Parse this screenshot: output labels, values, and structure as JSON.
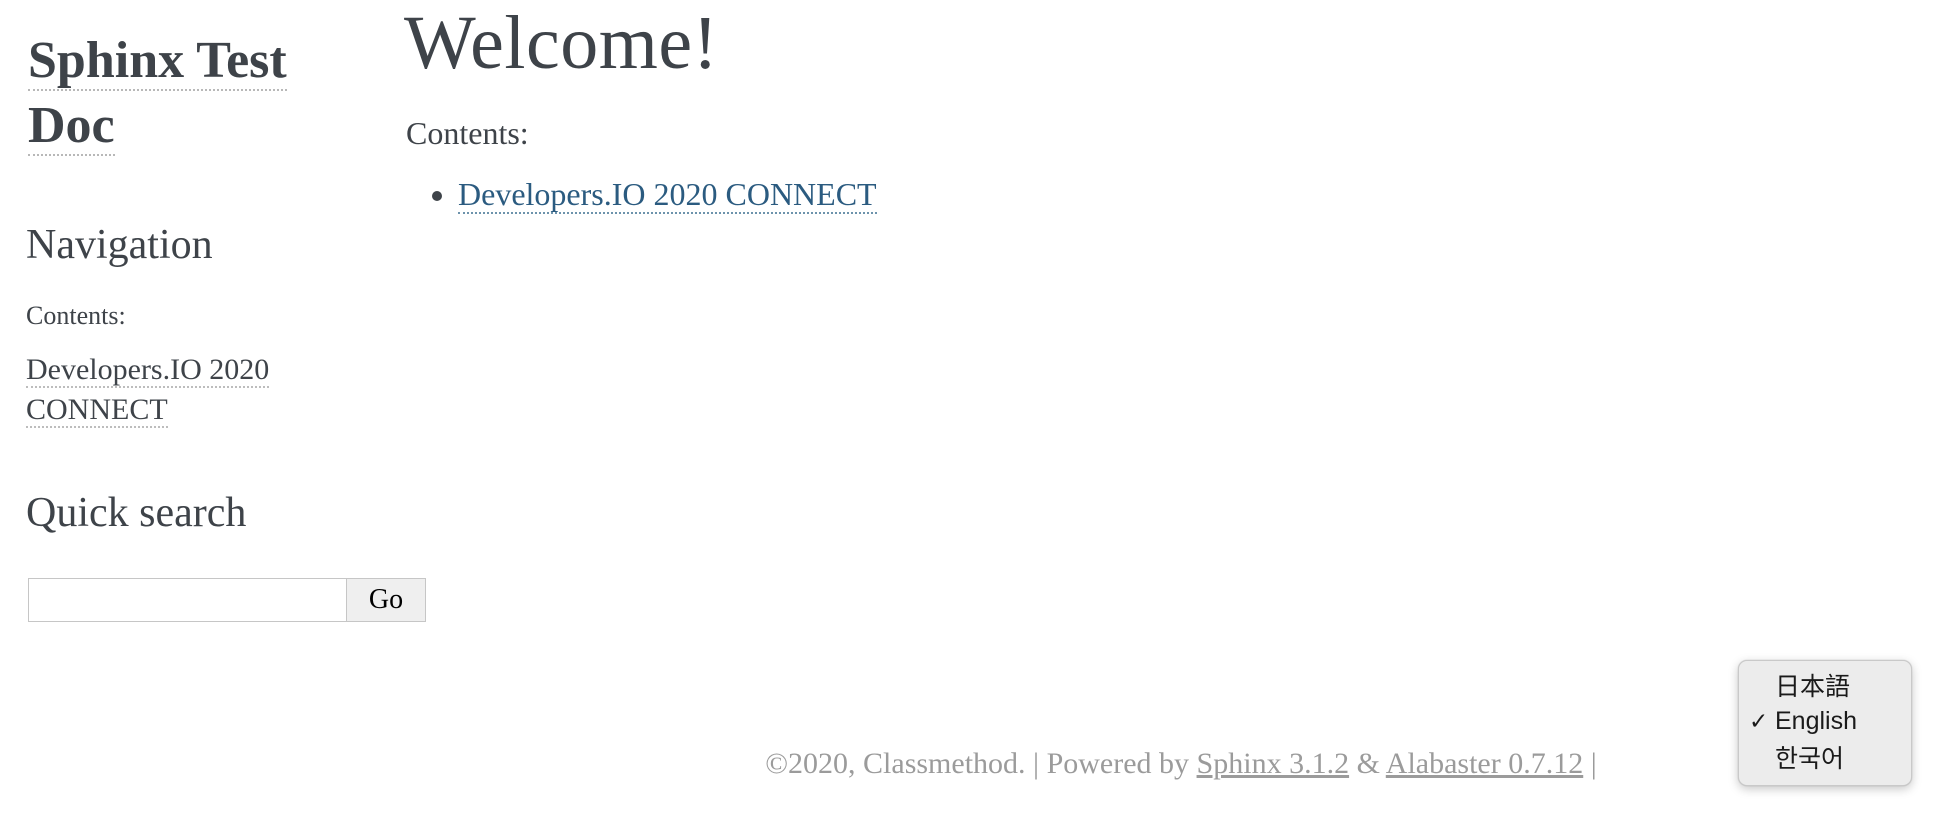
{
  "sidebar": {
    "site_title": "Sphinx Test Doc",
    "navigation_heading": "Navigation",
    "contents_label": "Contents:",
    "toc_items": [
      {
        "label": "Developers.IO 2020 CONNECT"
      }
    ],
    "search_heading": "Quick search",
    "search": {
      "value": "",
      "placeholder": "",
      "go_label": "Go"
    }
  },
  "content": {
    "title": "Welcome!",
    "contents_label": "Contents:",
    "toc_items": [
      {
        "label": "Developers.IO 2020 CONNECT"
      }
    ]
  },
  "footer": {
    "copyright": "©2020, Classmethod.",
    "separator_1": "|",
    "powered_by": "Powered by",
    "sphinx_link": "Sphinx 3.1.2",
    "ampersand": "&",
    "alabaster_link": "Alabaster 0.7.12",
    "separator_2": "|"
  },
  "language_menu": {
    "items": [
      {
        "label": "日本語",
        "checked": ""
      },
      {
        "label": "English",
        "checked": "✓"
      },
      {
        "label": "한국어",
        "checked": ""
      }
    ]
  },
  "colors": {
    "text": "#3E4349",
    "link": "#2b5b80",
    "footer_text": "#9b9b9b",
    "menu_bg": "#ececec",
    "button_bg": "#efefef"
  }
}
